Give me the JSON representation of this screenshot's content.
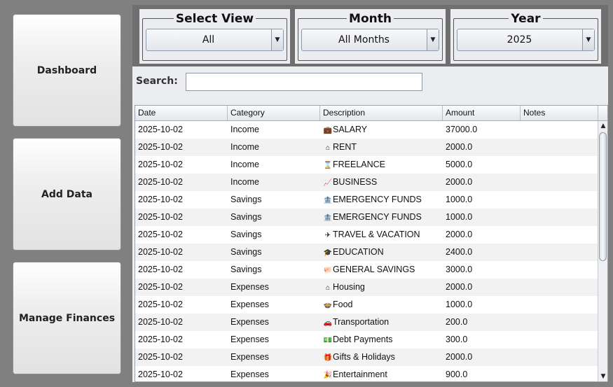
{
  "sidebar": {
    "dashboard_label": "Dashboard",
    "add_data_label": "Add Data",
    "manage_label": "Manage Finances"
  },
  "filters": {
    "view": {
      "legend": "Select View",
      "value": "All"
    },
    "month": {
      "legend": "Month",
      "value": "All Months"
    },
    "year": {
      "legend": "Year",
      "value": "2025"
    }
  },
  "search": {
    "label": "Search:",
    "value": ""
  },
  "table": {
    "columns": [
      "Date",
      "Category",
      "Description",
      "Amount",
      "Notes"
    ],
    "rows": [
      {
        "date": "2025-10-02",
        "category": "Income",
        "icon": "briefcase-icon",
        "description": "SALARY",
        "amount": "37000.0",
        "notes": ""
      },
      {
        "date": "2025-10-02",
        "category": "Income",
        "icon": "house-icon",
        "description": "RENT",
        "amount": "2000.0",
        "notes": ""
      },
      {
        "date": "2025-10-02",
        "category": "Income",
        "icon": "hourglass-icon",
        "description": "FREELANCE",
        "amount": "5000.0",
        "notes": ""
      },
      {
        "date": "2025-10-02",
        "category": "Income",
        "icon": "chart-icon",
        "description": "BUSINESS",
        "amount": "2000.0",
        "notes": ""
      },
      {
        "date": "2025-10-02",
        "category": "Savings",
        "icon": "bank-icon",
        "description": "EMERGENCY FUNDS",
        "amount": "1000.0",
        "notes": ""
      },
      {
        "date": "2025-10-02",
        "category": "Savings",
        "icon": "bank-icon",
        "description": "EMERGENCY FUNDS",
        "amount": "1000.0",
        "notes": ""
      },
      {
        "date": "2025-10-02",
        "category": "Savings",
        "icon": "airplane-icon",
        "description": "TRAVEL & VACATION",
        "amount": "2000.0",
        "notes": ""
      },
      {
        "date": "2025-10-02",
        "category": "Savings",
        "icon": "graduation-cap-icon",
        "description": "EDUCATION",
        "amount": "2400.0",
        "notes": ""
      },
      {
        "date": "2025-10-02",
        "category": "Savings",
        "icon": "piggy-bank-icon",
        "description": "GENERAL SAVINGS",
        "amount": "3000.0",
        "notes": ""
      },
      {
        "date": "2025-10-02",
        "category": "Expenses",
        "icon": "house-icon",
        "description": "Housing",
        "amount": "2000.0",
        "notes": ""
      },
      {
        "date": "2025-10-02",
        "category": "Expenses",
        "icon": "food-icon",
        "description": "Food",
        "amount": "1000.0",
        "notes": ""
      },
      {
        "date": "2025-10-02",
        "category": "Expenses",
        "icon": "car-icon",
        "description": "Transportation",
        "amount": "200.0",
        "notes": ""
      },
      {
        "date": "2025-10-02",
        "category": "Expenses",
        "icon": "cash-icon",
        "description": "Debt Payments",
        "amount": "300.0",
        "notes": ""
      },
      {
        "date": "2025-10-02",
        "category": "Expenses",
        "icon": "gift-icon",
        "description": "Gifts & Holidays",
        "amount": "2000.0",
        "notes": ""
      },
      {
        "date": "2025-10-02",
        "category": "Expenses",
        "icon": "party-icon",
        "description": "Entertainment",
        "amount": "900.0",
        "notes": ""
      }
    ]
  }
}
